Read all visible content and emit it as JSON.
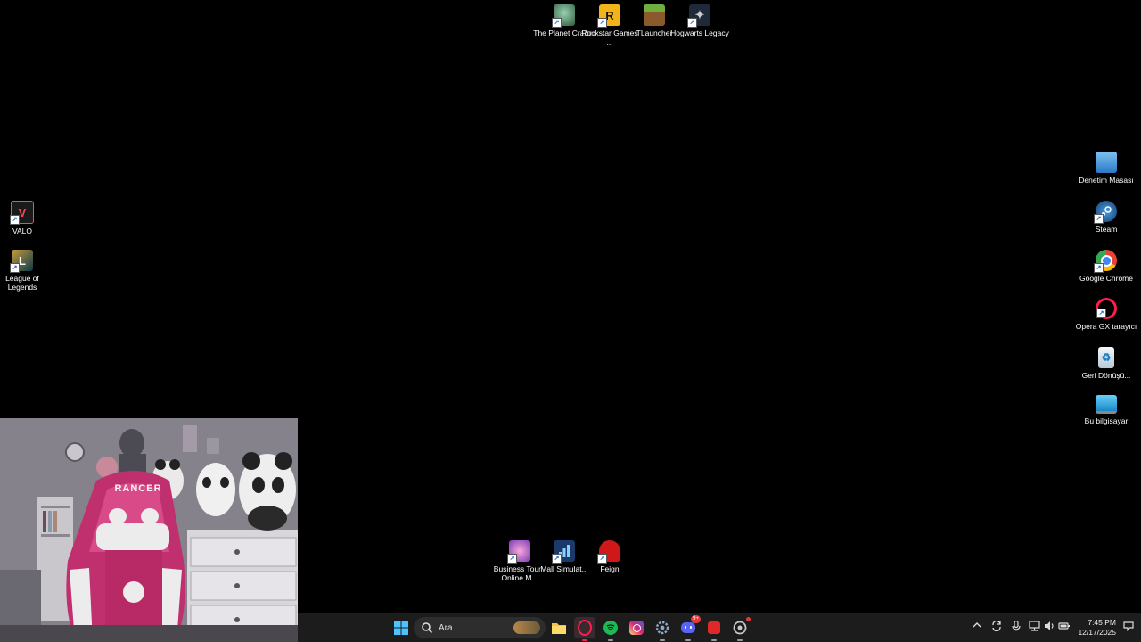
{
  "desktop_icons": [
    {
      "id": "planet-crafter",
      "label": "The Planet Crafter",
      "icon": "planet-crafter-icon",
      "color": "#3a6b3a"
    },
    {
      "id": "rockstar",
      "label": "Rockstar Games ...",
      "icon": "rockstar-icon",
      "color": "#f2b418"
    },
    {
      "id": "tlauncher",
      "label": "TLauncher",
      "icon": "grass-block-icon",
      "color": "#5b8a3a"
    },
    {
      "id": "hogwarts",
      "label": "Hogwarts Legacy",
      "icon": "hogwarts-icon",
      "color": "#1e2a3a"
    },
    {
      "id": "valo",
      "label": "VALO",
      "icon": "valorant-icon",
      "color": "#ff4655"
    },
    {
      "id": "lol",
      "label": "League of Legends",
      "icon": "league-icon",
      "color": "#c89b3c"
    },
    {
      "id": "denetim",
      "label": "Denetim Masası",
      "icon": "control-panel-icon",
      "color": "#3c8fd8"
    },
    {
      "id": "steam",
      "label": "Steam",
      "icon": "steam-icon",
      "color": "#1b6fb0"
    },
    {
      "id": "chrome",
      "label": "Google Chrome",
      "icon": "chrome-icon",
      "color": "#4285f4"
    },
    {
      "id": "opera",
      "label": "Opera GX tarayıcı",
      "icon": "opera-gx-icon",
      "color": "#fa1e4e"
    },
    {
      "id": "recycle",
      "label": "Geri Dönüşü...",
      "icon": "recycle-bin-icon",
      "color": "#dfe8f0"
    },
    {
      "id": "computer",
      "label": "Bu bilgisayar",
      "icon": "monitor-icon",
      "color": "#3ab0e8"
    },
    {
      "id": "business",
      "label": "Business Tour - Online M...",
      "icon": "business-tour-icon",
      "color": "#e86ab8"
    },
    {
      "id": "mall",
      "label": "Mall Simulat...",
      "icon": "mall-simulator-icon",
      "color": "#2a6db8"
    },
    {
      "id": "feign",
      "label": "Feign",
      "icon": "feign-icon",
      "color": "#d01818"
    }
  ],
  "webcam": {
    "chair_text": "RANCER"
  },
  "taskbar": {
    "search_placeholder": "Ara",
    "apps": [
      {
        "name": "file-explorer-icon",
        "color": "#f5c242"
      },
      {
        "name": "opera-gx-icon",
        "color": "#fa1e4e"
      },
      {
        "name": "spotify-icon",
        "color": "#1db954"
      },
      {
        "name": "instagram-icon",
        "color": "#d6249f"
      },
      {
        "name": "settings-app-icon",
        "color": "#8aa8c8"
      },
      {
        "name": "discord-icon",
        "color": "#5865f2",
        "badge": "9+"
      },
      {
        "name": "red-app-icon",
        "color": "#e02828"
      },
      {
        "name": "chrome-dev-icon",
        "color": "#c8c8c8"
      }
    ],
    "time": "7:45 PM",
    "date": "12/17/2025"
  }
}
